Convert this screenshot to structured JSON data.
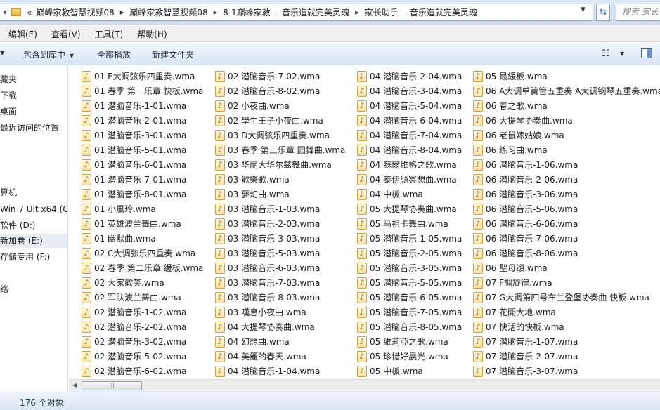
{
  "address": {
    "overflow": "«",
    "crumbs": [
      "巅峰家教智慧视频08",
      "巅峰家教智慧视频08",
      "8-1巅峰家教—-音乐造就完美灵魂",
      "家长助手—-音乐造就完美灵魂"
    ],
    "search_placeholder": "搜索 家长"
  },
  "menu": [
    "编辑(E)",
    "查看(V)",
    "工具(T)",
    "帮助(H)"
  ],
  "commands": {
    "include_library": "包含到库中",
    "play_all": "全部播放",
    "new_folder": "新建文件夹"
  },
  "nav": [
    "藏夹",
    "下载",
    "桌面",
    "最近访问的位置",
    "",
    "",
    "",
    "算机",
    "Win 7 Ult x64 (C:",
    "软件 (D:)",
    "新加卷 (E:)",
    "存储专用 (F:)",
    "",
    "络"
  ],
  "files": {
    "col1": [
      "01 E大调弦乐四重奏.wma",
      "01 春季 第一乐章 快板.wma",
      "01 潜脑音乐-1-01.wma",
      "01 潜脑音乐-2-01.wma",
      "01 潜脑音乐-3-01.wma",
      "01 潜脑音乐-5-01.wma",
      "01 潜脑音乐-6-01.wma",
      "01 潜脑音乐-7-01.wma",
      "01 潜脑音乐-8-01.wma",
      "01 小風玲.wma",
      "01 英雄波兰舞曲.wma",
      "01 幽默曲.wma",
      "02 C大调弦乐四重奏.wma",
      "02 春季 第二乐章 缓板.wma",
      "02 大家歡笑.wma",
      "02 军队波兰舞曲.wma",
      "02 潜脑音乐-1-02.wma",
      "02 潜脑音乐-2-02.wma",
      "02 潜脑音乐-3-02.wma",
      "02 潜脑音乐-5-02.wma",
      "02 潜脑音乐-6-02.wma"
    ],
    "col2": [
      "02 潜脑音乐-7-02.wma",
      "02 潜脑音乐-8-02.wma",
      "02 小夜曲.wma",
      "02 學生王子小夜曲.wma",
      "03 D大调弦乐四重奏.wma",
      "03 春季 第三乐章 园舞曲.wma",
      "03 华丽大华尔兹舞曲.wma",
      "03 歡樂歌.wma",
      "03 夢幻曲.wma",
      "03 潜脑音乐-1-03.wma",
      "03 潜脑音乐-2-03.wma",
      "03 潜脑音乐-3-03.wma",
      "03 潜脑音乐-5-03.wma",
      "03 潜脑音乐-6-03.wma",
      "03 潜脑音乐-7-03.wma",
      "03 潜脑音乐-8-03.wma",
      "03 嘆息小夜曲.wma",
      "04 大提琴协奏曲.wma",
      "04 幻想曲.wma",
      "04 美麗的春天.wma",
      "04 潜脑音乐-1-04.wma"
    ],
    "col3": [
      "04 潜脑音乐-2-04.wma",
      "04 潜脑音乐-3-04.wma",
      "04 潜脑音乐-5-04.wma",
      "04 潜脑音乐-6-04.wma",
      "04 潜脑音乐-7-04.wma",
      "04 潜脑音乐-8-04.wma",
      "04 蘇爾維格之歌.wma",
      "04 泰伊絲冥想曲.wma",
      "04 中板.wma",
      "05 大提琴协奏曲.wma",
      "05 马祖卡舞曲.wma",
      "05 潜脑音乐-1-05.wma",
      "05 潜脑音乐-2-05.wma",
      "05 潜脑音乐-3-05.wma",
      "05 潜脑音乐-5-05.wma",
      "05 潜脑音乐-6-05.wma",
      "05 潜脑音乐-7-05.wma",
      "05 潜脑音乐-8-05.wma",
      "05 維莉亞之歌.wma",
      "05 珍惜好晨光.wma",
      "05 中板.wma"
    ],
    "col4": [
      "05 最緩板.wma",
      "06 A大调单簧管五重奏 A大调钢琴五重奏.wma",
      "06 春之歌.wma",
      "06 大提琴协奏曲.wma",
      "06 老鼠嫁姑娘.wma",
      "06 练习曲.wma",
      "06 潜脑音乐-1-06.wma",
      "06 潜脑音乐-2-06.wma",
      "06 潜脑音乐-3-06.wma",
      "06 潜脑音乐-5-06.wma",
      "06 潜脑音乐-6-06.wma",
      "06 潜脑音乐-7-06.wma",
      "06 潜脑音乐-8-06.wma",
      "06 聖母頌.wma",
      "07 F調旋律.wma",
      "07 G大调第四号布兰登堡协奏曲 快板.wma",
      "07 花開大地.wma",
      "07 快活的快板.wma",
      "07 潜脑音乐-1-07.wma",
      "07 潜脑音乐-2-07.wma",
      "07 潜脑音乐-3-07.wma"
    ]
  },
  "status": {
    "count": "176 个对象"
  },
  "icons": {
    "file": "music-note-icon",
    "folder": "folder-icon",
    "refresh": "refresh-icon",
    "views": "views-icon",
    "preview_pane": "preview-pane-icon"
  },
  "colors": {
    "toolbar_top": "#f3f7fc",
    "toolbar_bottom": "#dae5f2",
    "selected_nav": "#e8eef6",
    "file_icon": "#f5e2a6"
  }
}
